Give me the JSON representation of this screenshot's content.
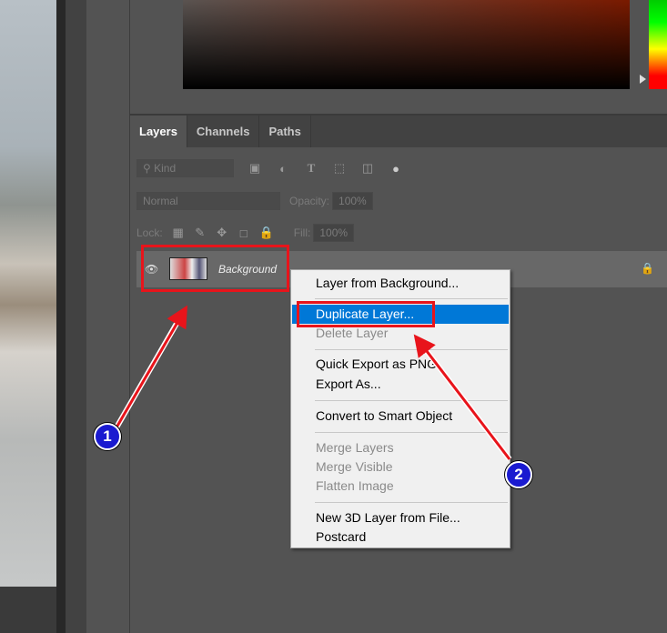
{
  "panel": {
    "tabs": [
      {
        "label": "Layers",
        "active": true
      },
      {
        "label": "Channels",
        "active": false
      },
      {
        "label": "Paths",
        "active": false
      }
    ],
    "filter_kind": "Kind",
    "blend_mode": "Normal",
    "opacity_label": "Opacity:",
    "opacity_value": "100%",
    "lock_label": "Lock:",
    "fill_label": "Fill:",
    "fill_value": "100%"
  },
  "layer": {
    "name": "Background",
    "locked": true
  },
  "context_menu": {
    "items": [
      {
        "label": "Layer from Background...",
        "enabled": true
      },
      {
        "label": "Duplicate Layer...",
        "enabled": true,
        "highlighted": true
      },
      {
        "label": "Delete Layer",
        "enabled": false
      },
      {
        "label": "Quick Export as PNG",
        "enabled": true
      },
      {
        "label": "Export As...",
        "enabled": true
      },
      {
        "label": "Convert to Smart Object",
        "enabled": true
      },
      {
        "label": "Merge Layers",
        "enabled": false
      },
      {
        "label": "Merge Visible",
        "enabled": false
      },
      {
        "label": "Flatten Image",
        "enabled": false
      },
      {
        "label": "New 3D Layer from File...",
        "enabled": true
      },
      {
        "label": "Postcard",
        "enabled": true
      }
    ]
  },
  "annotations": {
    "step1": "1",
    "step2": "2",
    "highlight_color": "#e8141b",
    "badge_color": "#1a1ad0"
  }
}
